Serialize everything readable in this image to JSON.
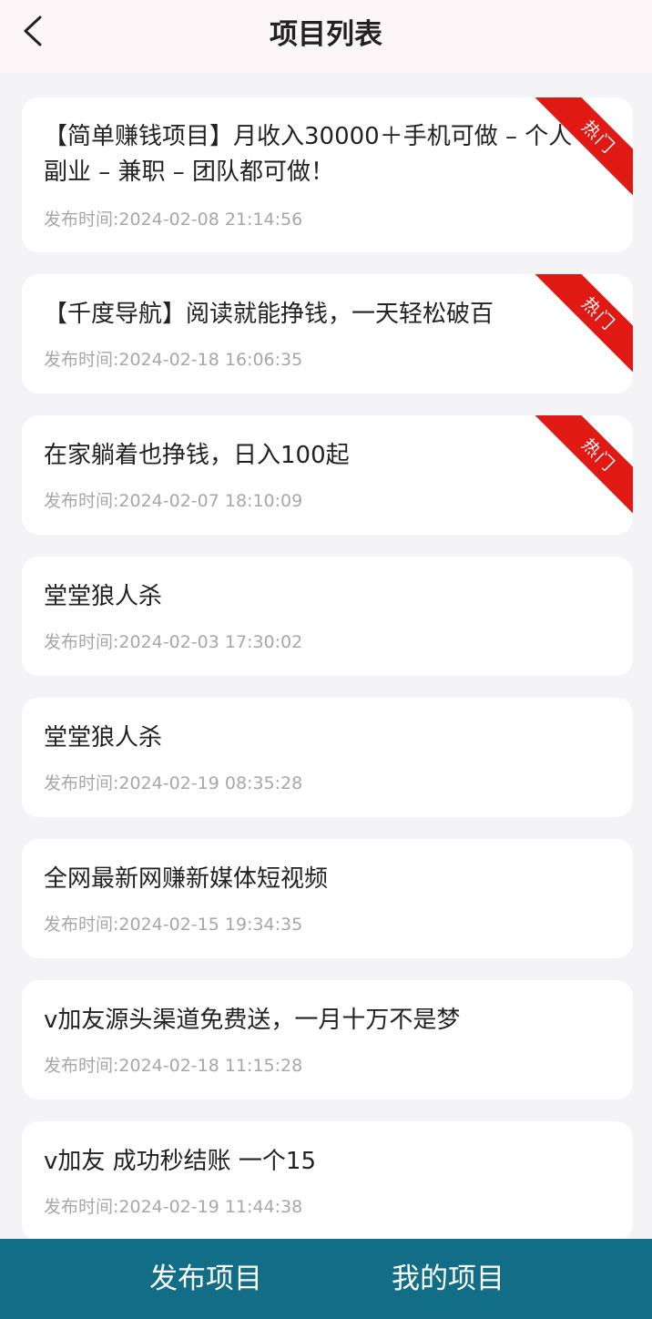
{
  "header": {
    "title": "项目列表"
  },
  "projects": [
    {
      "title": "【简单赚钱项目】月收入30000＋手机可做 – 个人 – 副业 – 兼职 – 团队都可做！",
      "time": "发布时间:2024-02-08 21:14:56",
      "badge": "热门"
    },
    {
      "title": "【千度导航】阅读就能挣钱，一天轻松破百",
      "time": "发布时间:2024-02-18 16:06:35",
      "badge": "热门"
    },
    {
      "title": "在家躺着也挣钱，日入100起",
      "time": "发布时间:2024-02-07 18:10:09",
      "badge": "热门"
    },
    {
      "title": "堂堂狼人杀",
      "time": "发布时间:2024-02-03 17:30:02"
    },
    {
      "title": "堂堂狼人杀",
      "time": "发布时间:2024-02-19 08:35:28"
    },
    {
      "title": "全网最新网赚新媒体短视频",
      "time": "发布时间:2024-02-15 19:34:35"
    },
    {
      "title": "v加友源头渠道免费送，一月十万不是梦",
      "time": "发布时间:2024-02-18 11:15:28"
    },
    {
      "title": "v加友 成功秒结账 一个15",
      "time": "发布时间:2024-02-19 11:44:38"
    }
  ],
  "bottom_nav": {
    "publish_label": "发布项目",
    "mine_label": "我的项目"
  },
  "colors": {
    "page_background": "#f4f4f6",
    "header_background": "#fdf6f8",
    "hot_badge": "#e01914",
    "bottom_bar": "#116e86",
    "time_text": "#a7a7a7"
  }
}
